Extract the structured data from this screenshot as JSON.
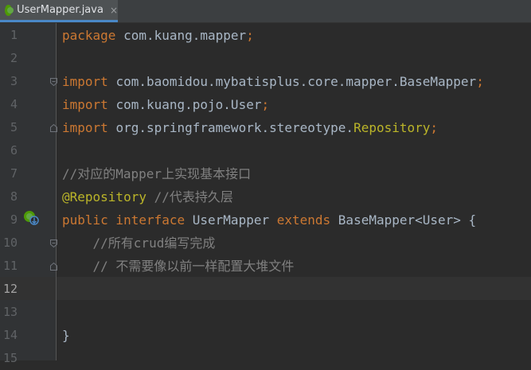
{
  "tab": {
    "label": "UserMapper.java",
    "close": "×",
    "icon": "java-class-icon"
  },
  "lines": [
    {
      "num": "1",
      "parts": [
        {
          "t": "package ",
          "c": "kw"
        },
        {
          "t": "com.kuang.mapper",
          "c": ""
        },
        {
          "t": ";",
          "c": "kw"
        }
      ]
    },
    {
      "num": "2",
      "parts": []
    },
    {
      "num": "3",
      "parts": [
        {
          "t": "import ",
          "c": "kw"
        },
        {
          "t": "com.baomidou.mybatisplus.core.mapper.BaseMapper",
          "c": ""
        },
        {
          "t": ";",
          "c": "kw"
        }
      ]
    },
    {
      "num": "4",
      "parts": [
        {
          "t": "import ",
          "c": "kw"
        },
        {
          "t": "com.kuang.pojo.User",
          "c": ""
        },
        {
          "t": ";",
          "c": "kw"
        }
      ]
    },
    {
      "num": "5",
      "parts": [
        {
          "t": "import ",
          "c": "kw"
        },
        {
          "t": "org.springframework.stereotype.",
          "c": ""
        },
        {
          "t": "Repository",
          "c": "ann"
        },
        {
          "t": ";",
          "c": "kw"
        }
      ]
    },
    {
      "num": "6",
      "parts": []
    },
    {
      "num": "7",
      "parts": [
        {
          "t": "//对应的Mapper上实现基本接口",
          "c": "cmt"
        }
      ]
    },
    {
      "num": "8",
      "parts": [
        {
          "t": "@Repository",
          "c": "ann"
        },
        {
          "t": " ",
          "c": ""
        },
        {
          "t": "//代表持久层",
          "c": "cmt"
        }
      ]
    },
    {
      "num": "9",
      "parts": [
        {
          "t": "public interface ",
          "c": "kw"
        },
        {
          "t": "UserMapper ",
          "c": ""
        },
        {
          "t": "extends ",
          "c": "kw"
        },
        {
          "t": "BaseMapper<User> {",
          "c": ""
        }
      ]
    },
    {
      "num": "10",
      "parts": [
        {
          "t": "    //所有crud编写完成",
          "c": "cmt"
        }
      ]
    },
    {
      "num": "11",
      "parts": [
        {
          "t": "    // 不需要像以前一样配置大堆文件",
          "c": "cmt"
        }
      ]
    },
    {
      "num": "12",
      "parts": []
    },
    {
      "num": "13",
      "parts": []
    },
    {
      "num": "14",
      "parts": [
        {
          "t": "}",
          "c": ""
        }
      ]
    },
    {
      "num": "15",
      "parts": []
    }
  ],
  "active_line": "12",
  "colors": {
    "keyword": "#cc7832",
    "annotation": "#bbb529",
    "comment": "#808080",
    "text": "#a9b7c6",
    "background": "#2b2b2b"
  }
}
